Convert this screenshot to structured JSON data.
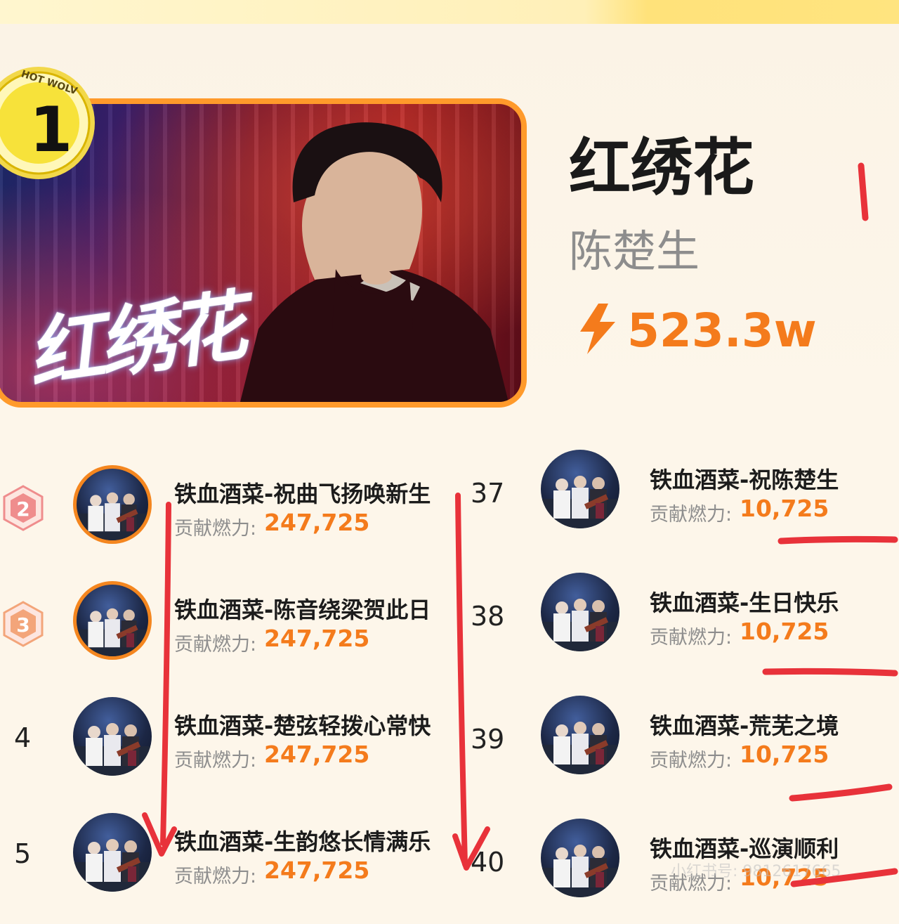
{
  "hero": {
    "rank": "1",
    "badge_text": "HOT WOLV",
    "cover_calligraphy": "红绣花",
    "title": "红绣花",
    "artist": "陈楚生",
    "heat": "523.3w",
    "heat_icon": "lightning-icon"
  },
  "contribution_label": "贡献燃力:",
  "left_list": [
    {
      "rank": "2",
      "title": "铁血酒菜-祝曲飞扬唤新生",
      "value": "247,725"
    },
    {
      "rank": "3",
      "title": "铁血酒菜-陈音绕梁贺此日",
      "value": "247,725"
    },
    {
      "rank": "4",
      "title": "铁血酒菜-楚弦轻拨心常快",
      "value": "247,725"
    },
    {
      "rank": "5",
      "title": "铁血酒菜-生韵悠长情满乐",
      "value": "247,725"
    }
  ],
  "right_list": [
    {
      "rank": "37",
      "title": "铁血酒菜-祝陈楚生",
      "value": "10,725"
    },
    {
      "rank": "38",
      "title": "铁血酒菜-生日快乐",
      "value": "10,725"
    },
    {
      "rank": "39",
      "title": "铁血酒菜-荒芜之境",
      "value": "10,725"
    },
    {
      "rank": "40",
      "title": "铁血酒菜-巡演顺利",
      "value": "10,725"
    }
  ],
  "watermark": "小红书号: 9812617665",
  "colors": {
    "accent": "#f47b1c",
    "ring": "#f4861f",
    "annotation": "#e8323a",
    "badge_yellow": "#f7e23a"
  }
}
